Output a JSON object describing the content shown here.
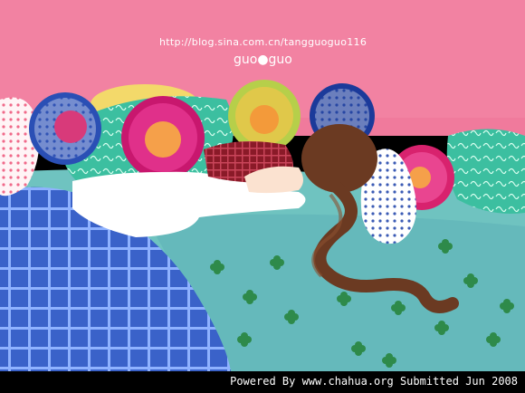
{
  "watermark": {
    "url": "http://blog.sina.com.cn/tangguoguo116",
    "signature": "guo●guo"
  },
  "footer": {
    "text": "Powered By www.chahua.org  Submitted Jun 2008"
  },
  "colors": {
    "wall": "#f07a9c",
    "bed": "#6fc3c0",
    "blanket": "#3a62c9",
    "footer_bg": "#000000"
  }
}
